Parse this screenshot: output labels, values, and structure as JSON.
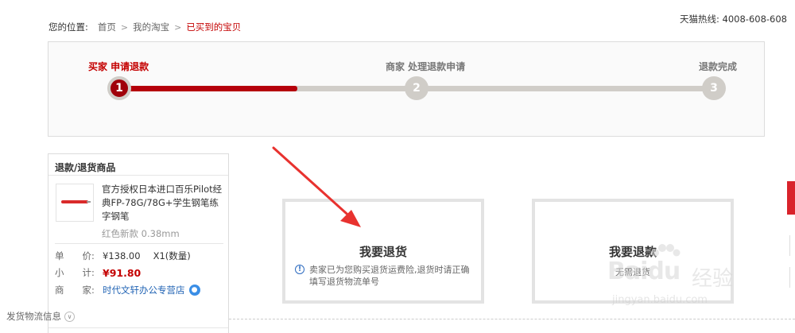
{
  "breadcrumb": {
    "label": "您的位置:",
    "items": [
      "首页",
      "我的淘宝",
      "已买到的宝贝"
    ],
    "separator": ">"
  },
  "hotline": "天猫热线: 4008-608-608",
  "progress": {
    "steps": [
      {
        "label": "买家 申请退款",
        "number": "1",
        "active": true
      },
      {
        "label": "商家 处理退款申请",
        "number": "2",
        "active": false
      },
      {
        "label": "退款完成",
        "number": "3",
        "active": false
      }
    ],
    "current_step": 1,
    "fill_fraction": 0.3
  },
  "product": {
    "panel_title": "退款/退货商品",
    "name": "官方授权日本进口百乐Pilot经典FP-78G/78G+学生钢笔练字钢笔",
    "sku": "红色新款 0.38mm",
    "unit_price_label": "单　　价:",
    "unit_price": "¥138.00",
    "quantity": "X1(数量)",
    "subtotal_label": "小　　计:",
    "subtotal": "¥91.80",
    "shop_label": "商　　家:",
    "shop_name": "时代文轩办公专营店",
    "shipping_info": "发货物流信息"
  },
  "actions": {
    "return_goods": {
      "title": "我要退货",
      "note": "卖家已为您购买退货运费险,退货时请正确填写退货物流单号"
    },
    "refund_only": {
      "title": "我要退款",
      "note": "无需退货"
    }
  },
  "watermark": {
    "brand": "Baidu",
    "product": "经验",
    "url": "jingyan.baidu.com"
  },
  "colors": {
    "accent_red": "#c40000",
    "step_active": "#a0000a",
    "track": "#d0cdc8",
    "link_blue": "#2365b5",
    "arrow_red": "#e8322f"
  }
}
